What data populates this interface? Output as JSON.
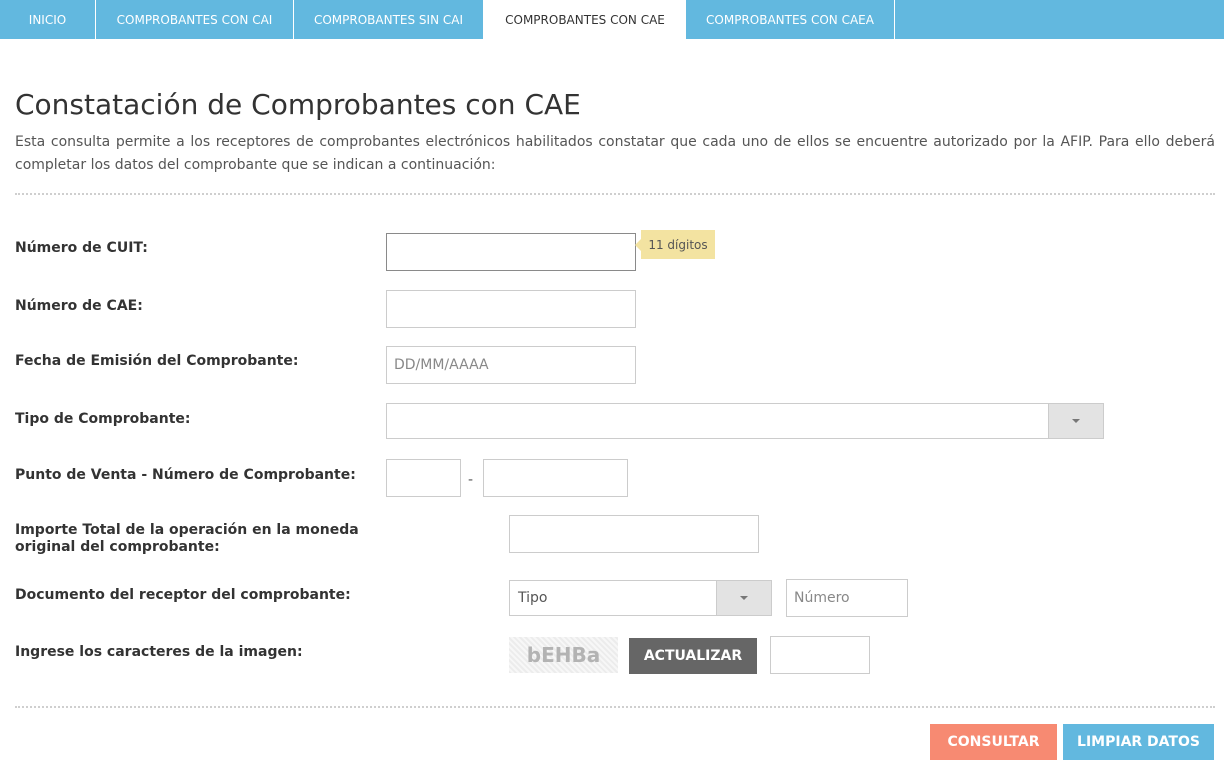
{
  "nav": {
    "tabs": [
      {
        "label": "INICIO"
      },
      {
        "label": "COMPROBANTES CON CAI"
      },
      {
        "label": "COMPROBANTES SIN CAI"
      },
      {
        "label": "COMPROBANTES CON CAE"
      },
      {
        "label": "COMPROBANTES CON CAEA"
      }
    ],
    "active": "COMPROBANTES CON CAE",
    "color": "#62b8df"
  },
  "page": {
    "title": "Constatación de Comprobantes con CAE",
    "description": "Esta consulta permite a los receptores de comprobantes electrónicos habilitados constatar que cada uno de ellos se encuentre autorizado por la AFIP. Para ello deberá completar los datos del comprobante que se indican a continuación:"
  },
  "form": {
    "cuit_label": "Número de CUIT:",
    "cuit_value": "",
    "cuit_hint": "11 dígitos",
    "cae_label": "Número de CAE:",
    "cae_value": "",
    "fecha_label": "Fecha de Emisión del Comprobante:",
    "fecha_placeholder": "DD/MM/AAAA",
    "tipo_label": "Tipo de Comprobante:",
    "tipo_value": "",
    "punto_label": "Punto de Venta - Número de Comprobante:",
    "punto_value": "",
    "numero_value": "",
    "separator": "-",
    "importe_label": "Importe Total de la operación en la moneda original del comprobante:",
    "importe_value": "",
    "documento_label": "Documento del receptor del comprobante:",
    "doc_tipo_value": "Tipo",
    "doc_numero_placeholder": "Número",
    "captcha_label": "Ingrese los caracteres de la imagen:",
    "captcha_text": "bEHBa",
    "actualizar_label": "ACTUALIZAR",
    "captcha_value": ""
  },
  "actions": {
    "consultar_label": "CONSULTAR",
    "limpiar_label": "LIMPIAR DATOS",
    "consultar_color": "#f78a72",
    "limpiar_color": "#62b8df",
    "actualizar_color": "#666666"
  },
  "icons": {
    "dropdown": "chevron-down-icon"
  }
}
